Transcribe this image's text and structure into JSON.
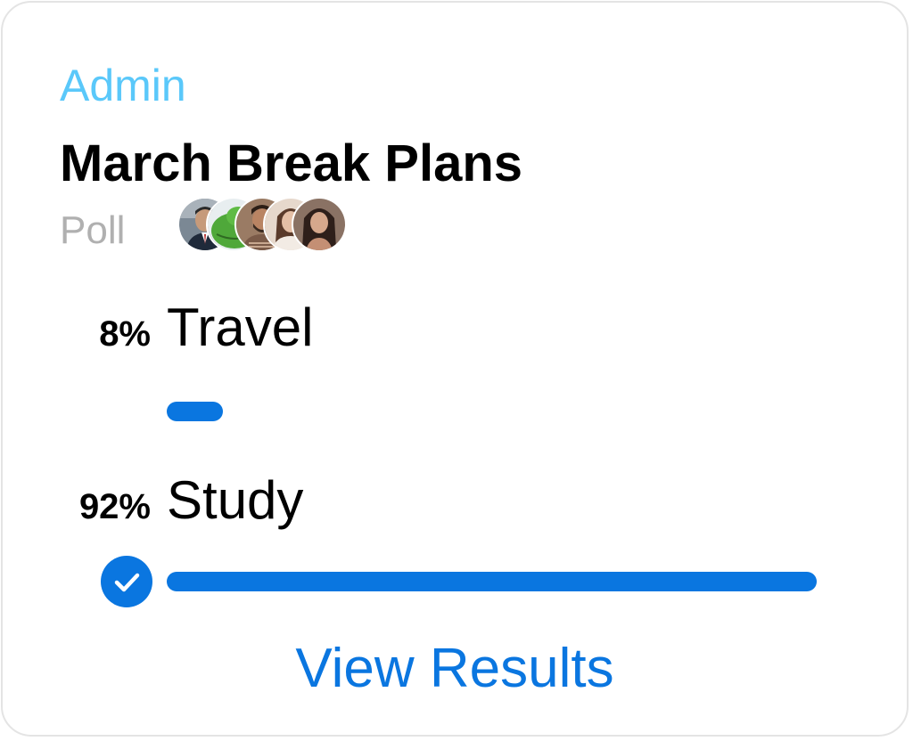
{
  "message": {
    "sender": "Admin",
    "title": "March Break Plans",
    "type_label": "Poll"
  },
  "voters": [
    {
      "icon": "avatar-man-suit",
      "bg": "#6f7b86"
    },
    {
      "icon": "avatar-green-frog",
      "bg": "#5fb04a"
    },
    {
      "icon": "avatar-man-beard",
      "bg": "#8a6a55"
    },
    {
      "icon": "avatar-woman-light",
      "bg": "#d8c2b4"
    },
    {
      "icon": "avatar-woman-dark",
      "bg": "#6a5248"
    }
  ],
  "options": [
    {
      "label": "Travel",
      "percent_text": "8%",
      "percent": 8,
      "selected": false
    },
    {
      "label": "Study",
      "percent_text": "92%",
      "percent": 92,
      "selected": true
    }
  ],
  "actions": {
    "view_results": "View Results"
  },
  "colors": {
    "accent": "#0a76e0",
    "sender": "#5ac8fa",
    "secondary_text": "#b0b0b0"
  }
}
